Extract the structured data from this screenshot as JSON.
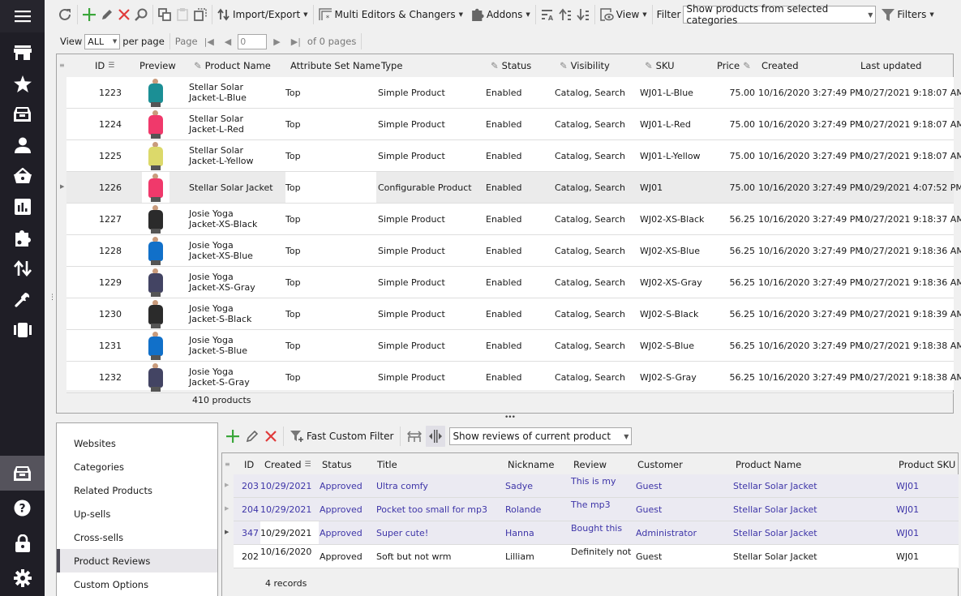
{
  "sidebar": {
    "menu_icon": "hamburger-icon",
    "items": [
      {
        "icon": "store-icon"
      },
      {
        "icon": "star-icon"
      },
      {
        "icon": "archive-box-icon"
      },
      {
        "icon": "user-icon"
      },
      {
        "icon": "basket-icon"
      },
      {
        "icon": "bar-chart-icon"
      },
      {
        "icon": "puzzle-icon"
      },
      {
        "icon": "import-export-arrows-icon"
      },
      {
        "icon": "wrench-icon"
      },
      {
        "icon": "columns-icon"
      }
    ],
    "bottom_items": [
      {
        "icon": "archive-box-icon",
        "active": true
      },
      {
        "icon": "help-icon"
      },
      {
        "icon": "lock-icon"
      },
      {
        "icon": "gear-icon"
      }
    ]
  },
  "toolbar": {
    "import_export": "Import/Export",
    "multi_editors": "Multi Editors & Changers",
    "addons": "Addons",
    "view": "View",
    "filter_label": "Filter",
    "filter_value": "Show products from selected categories",
    "filters": "Filters"
  },
  "pager": {
    "view_label": "View",
    "view_value": "ALL",
    "per_page": "per page",
    "page_label": "Page",
    "page_value": "0",
    "of_pages": "of 0 pages"
  },
  "products": {
    "columns": {
      "id": "ID",
      "preview": "Preview",
      "name": "Product Name",
      "attr_set": "Attribute Set Name",
      "type": "Type",
      "status": "Status",
      "visibility": "Visibility",
      "sku": "SKU",
      "price": "Price",
      "created": "Created",
      "updated": "Last updated"
    },
    "rows": [
      {
        "id": "1223",
        "color": "#1b8f95",
        "name1": "Stellar Solar",
        "name2": "Jacket-L-Blue",
        "attr_set": "Top",
        "type": "Simple Product",
        "status": "Enabled",
        "visibility": "Catalog, Search",
        "sku": "WJ01-L-Blue",
        "price": "75.00",
        "created": "10/16/2020 3:27:49 PM",
        "updated": "10/27/2021 9:18:07 AM"
      },
      {
        "id": "1224",
        "color": "#f0396b",
        "name1": "Stellar Solar",
        "name2": "Jacket-L-Red",
        "attr_set": "Top",
        "type": "Simple Product",
        "status": "Enabled",
        "visibility": "Catalog, Search",
        "sku": "WJ01-L-Red",
        "price": "75.00",
        "created": "10/16/2020 3:27:49 PM",
        "updated": "10/27/2021 9:18:07 AM"
      },
      {
        "id": "1225",
        "color": "#dcd96a",
        "name1": "Stellar Solar",
        "name2": "Jacket-L-Yellow",
        "attr_set": "Top",
        "type": "Simple Product",
        "status": "Enabled",
        "visibility": "Catalog, Search",
        "sku": "WJ01-L-Yellow",
        "price": "75.00",
        "created": "10/16/2020 3:27:49 PM",
        "updated": "10/27/2021 9:18:07 AM"
      },
      {
        "id": "1226",
        "color": "#f0396b",
        "name1": "Stellar Solar Jacket",
        "name2": "",
        "attr_set": "Top",
        "type": "Configurable Product",
        "status": "Enabled",
        "visibility": "Catalog, Search",
        "sku": "WJ01",
        "price": "75.00",
        "created": "10/16/2020 3:27:49 PM",
        "updated": "10/29/2021 4:07:52 PM",
        "selected": true
      },
      {
        "id": "1227",
        "color": "#2b2b2b",
        "name1": "Josie Yoga",
        "name2": "Jacket-XS-Black",
        "attr_set": "Top",
        "type": "Simple Product",
        "status": "Enabled",
        "visibility": "Catalog, Search",
        "sku": "WJ02-XS-Black",
        "price": "56.25",
        "created": "10/16/2020 3:27:49 PM",
        "updated": "10/27/2021 9:18:37 AM"
      },
      {
        "id": "1228",
        "color": "#1170c9",
        "name1": "Josie Yoga",
        "name2": "Jacket-XS-Blue",
        "attr_set": "Top",
        "type": "Simple Product",
        "status": "Enabled",
        "visibility": "Catalog, Search",
        "sku": "WJ02-XS-Blue",
        "price": "56.25",
        "created": "10/16/2020 3:27:49 PM",
        "updated": "10/27/2021 9:18:36 AM"
      },
      {
        "id": "1229",
        "color": "#434463",
        "name1": "Josie Yoga",
        "name2": "Jacket-XS-Gray",
        "attr_set": "Top",
        "type": "Simple Product",
        "status": "Enabled",
        "visibility": "Catalog, Search",
        "sku": "WJ02-XS-Gray",
        "price": "56.25",
        "created": "10/16/2020 3:27:49 PM",
        "updated": "10/27/2021 9:18:36 AM"
      },
      {
        "id": "1230",
        "color": "#2b2b2b",
        "name1": "Josie Yoga",
        "name2": "Jacket-S-Black",
        "attr_set": "Top",
        "type": "Simple Product",
        "status": "Enabled",
        "visibility": "Catalog, Search",
        "sku": "WJ02-S-Black",
        "price": "56.25",
        "created": "10/16/2020 3:27:49 PM",
        "updated": "10/27/2021 9:18:39 AM"
      },
      {
        "id": "1231",
        "color": "#1170c9",
        "name1": "Josie Yoga",
        "name2": "Jacket-S-Blue",
        "attr_set": "Top",
        "type": "Simple Product",
        "status": "Enabled",
        "visibility": "Catalog, Search",
        "sku": "WJ02-S-Blue",
        "price": "56.25",
        "created": "10/16/2020 3:27:49 PM",
        "updated": "10/27/2021 9:18:38 AM"
      },
      {
        "id": "1232",
        "color": "#434463",
        "name1": "Josie Yoga",
        "name2": "Jacket-S-Gray",
        "attr_set": "Top",
        "type": "Simple Product",
        "status": "Enabled",
        "visibility": "Catalog, Search",
        "sku": "WJ02-S-Gray",
        "price": "56.25",
        "created": "10/16/2020 3:27:49 PM",
        "updated": "10/27/2021 9:18:38 AM"
      }
    ],
    "footer": "410 products"
  },
  "detail_tabs": {
    "items": [
      "Websites",
      "Categories",
      "Related Products",
      "Up-sells",
      "Cross-sells",
      "Product Reviews",
      "Custom Options"
    ],
    "active": "Product Reviews"
  },
  "reviews": {
    "toolbar": {
      "fast_filter": "Fast Custom Filter",
      "scope_value": "Show reviews of current product"
    },
    "columns": {
      "id": "ID",
      "created": "Created",
      "status": "Status",
      "title": "Title",
      "nickname": "Nickname",
      "review": "Review",
      "customer": "Customer",
      "product_name": "Product Name",
      "product_sku": "Product SKU"
    },
    "rows": [
      {
        "id": "203",
        "created": "10/29/2021",
        "status": "Approved",
        "title": "Ultra comfy",
        "nickname": "Sadye",
        "review": "This is my",
        "customer": "Guest",
        "product_name": "Stellar Solar Jacket",
        "product_sku": "WJ01"
      },
      {
        "id": "204",
        "created": "10/29/2021",
        "status": "Approved",
        "title": "Pocket too small for mp3",
        "nickname": "Rolande",
        "review": "The mp3",
        "customer": "Guest",
        "product_name": "Stellar Solar Jacket",
        "product_sku": "WJ01"
      },
      {
        "id": "347",
        "created": "10/29/2021",
        "status": "Approved",
        "title": "Super cute!",
        "nickname": "Hanna",
        "review": "Bought this",
        "customer": "Administrator",
        "product_name": "Stellar Solar Jacket",
        "product_sku": "WJ01"
      },
      {
        "id": "202",
        "created": "10/16/2020",
        "status": "Approved",
        "title": "Soft but not wrm",
        "nickname": "Lilliam",
        "review": "Definitely not",
        "customer": "Guest",
        "product_name": "Stellar Solar Jacket",
        "product_sku": "WJ01"
      }
    ],
    "footer": "4 records"
  },
  "colors": {
    "sidebar_bg": "#1f1e26",
    "highlight_text": "#3e35a8",
    "add_green": "#3aa63a",
    "delete_red": "#e03a3a"
  }
}
